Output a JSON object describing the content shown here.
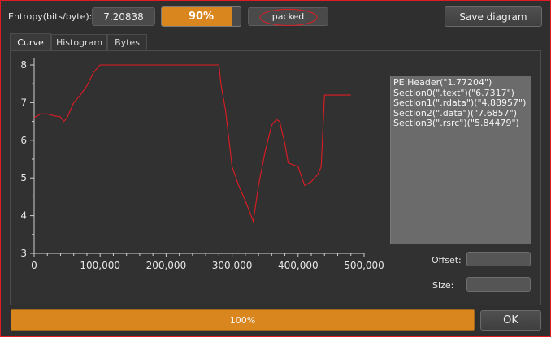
{
  "toolbar": {
    "entropy_label": "Entropy(bits/byte):",
    "entropy_value": "7.20838",
    "percent_value": "90%",
    "percent_fraction": 0.9,
    "status": "packed",
    "save_label": "Save diagram"
  },
  "tabs": [
    {
      "label": "Curve",
      "active": true
    },
    {
      "label": "Histogram",
      "active": false
    },
    {
      "label": "Bytes",
      "active": false
    }
  ],
  "sections": [
    "PE Header(\"1.77204\")",
    "Section0(\".text\")(\"6.7317\")",
    "Section1(\".rdata\")(\"4.88957\")",
    "Section2(\".data\")(\"7.6857\")",
    "Section3(\".rsrc\")(\"5.84479\")"
  ],
  "fields": {
    "offset_label": "Offset:",
    "size_label": "Size:"
  },
  "footer": {
    "progress_label": "100%",
    "progress_fraction": 1.0,
    "ok_label": "OK"
  },
  "colors": {
    "accent": "#d9861e",
    "curve": "#e01b24",
    "frame": "#e01b24"
  },
  "chart_data": {
    "type": "line",
    "title": "",
    "xlabel": "",
    "ylabel": "",
    "xlim": [
      0,
      500000
    ],
    "ylim": [
      3,
      8
    ],
    "x_ticks": [
      "0",
      "100,000",
      "200,000",
      "300,000",
      "400,000",
      "500,000"
    ],
    "y_ticks": [
      "3",
      "4",
      "5",
      "6",
      "7",
      "8"
    ],
    "grid": false,
    "series": [
      {
        "x": [
          0,
          10000,
          20000,
          30000,
          40000,
          45000,
          50000,
          60000,
          70000,
          80000,
          90000,
          100000,
          150000,
          200000,
          250000,
          280000,
          283000,
          290000,
          300000,
          310000,
          320000,
          332000,
          340000,
          350000,
          360000,
          367000,
          372000,
          380000,
          385000,
          400000,
          410000,
          420000,
          430000,
          435000,
          440000,
          460000,
          480000
        ],
        "y": [
          6.6,
          6.7,
          6.7,
          6.65,
          6.62,
          6.5,
          6.6,
          7.0,
          7.2,
          7.45,
          7.8,
          8.0,
          8.0,
          8.0,
          8.0,
          8.0,
          7.5,
          6.8,
          5.3,
          4.8,
          4.4,
          3.85,
          4.8,
          5.7,
          6.4,
          6.55,
          6.5,
          5.9,
          5.4,
          5.3,
          4.8,
          4.9,
          5.1,
          5.3,
          7.2,
          7.2,
          7.2
        ]
      }
    ]
  }
}
